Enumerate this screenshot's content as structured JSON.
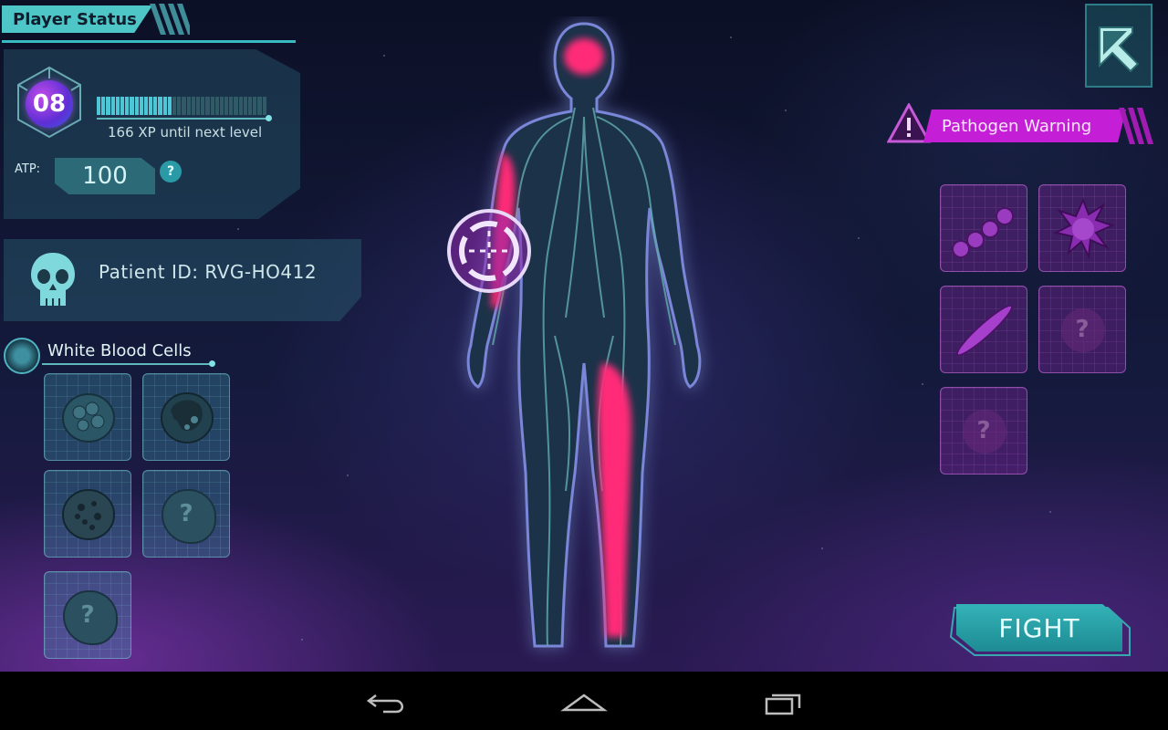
{
  "player_status": {
    "title": "Player Status",
    "level": "08",
    "xp_progress": 0.45,
    "xp_text": "166 XP until next level",
    "atp_label": "ATP:",
    "atp_value": "100",
    "help_label": "?"
  },
  "patient": {
    "label": "Patient ID: RVG-HO412",
    "icon": "skull-icon"
  },
  "white_blood_cells": {
    "title": "White Blood Cells",
    "cells": [
      {
        "name": "wbc-cell-1",
        "locked": false
      },
      {
        "name": "wbc-cell-2",
        "locked": false
      },
      {
        "name": "wbc-cell-3",
        "locked": false
      },
      {
        "name": "wbc-cell-4",
        "locked": true,
        "label": "?"
      },
      {
        "name": "wbc-cell-5",
        "locked": true,
        "label": "?"
      }
    ]
  },
  "pathogen_warning": {
    "title": "Pathogen Warning",
    "warning_icon": "warning-triangle-icon",
    "pathogens": [
      {
        "name": "pathogen-chain",
        "locked": false
      },
      {
        "name": "pathogen-spiky",
        "locked": false
      },
      {
        "name": "pathogen-rod",
        "locked": false
      },
      {
        "name": "pathogen-unknown-1",
        "locked": true,
        "label": "?"
      },
      {
        "name": "pathogen-unknown-2",
        "locked": true,
        "label": "?"
      }
    ]
  },
  "fight_button": {
    "label": "FIGHT"
  },
  "map_button": {
    "icon": "map-icon"
  },
  "nav": {
    "back": "back-icon",
    "home": "home-icon",
    "recents": "recents-icon"
  },
  "colors": {
    "accent_teal": "#4ec6c8",
    "pathogen_magenta": "#c41fd6",
    "infection_pink": "#ff1e6e",
    "body_fill": "#1e3048"
  }
}
